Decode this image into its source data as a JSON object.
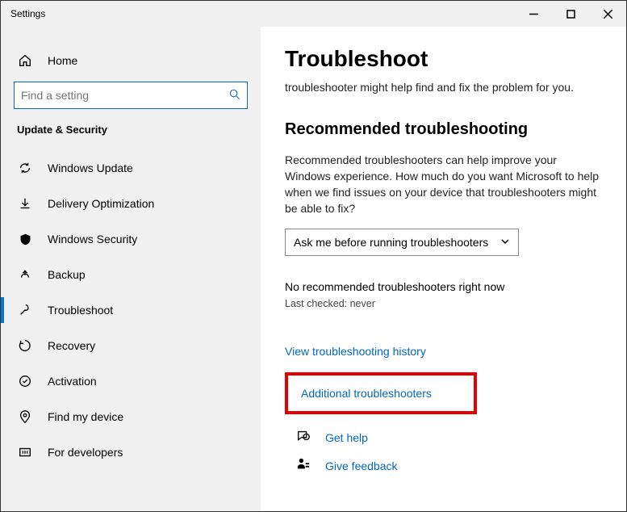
{
  "window": {
    "title": "Settings"
  },
  "sidebar": {
    "home": "Home",
    "search_placeholder": "Find a setting",
    "section": "Update & Security",
    "items": [
      {
        "label": "Windows Update"
      },
      {
        "label": "Delivery Optimization"
      },
      {
        "label": "Windows Security"
      },
      {
        "label": "Backup"
      },
      {
        "label": "Troubleshoot"
      },
      {
        "label": "Recovery"
      },
      {
        "label": "Activation"
      },
      {
        "label": "Find my device"
      },
      {
        "label": "For developers"
      }
    ]
  },
  "content": {
    "title": "Troubleshoot",
    "desc": "troubleshooter might help find and fix the problem for you.",
    "section_title": "Recommended troubleshooting",
    "section_desc": "Recommended troubleshooters can help improve your Windows experience. How much do you want Microsoft to help when we find issues on your device that troubleshooters might be able to fix?",
    "dropdown_value": "Ask me before running troubleshooters",
    "status": "No recommended troubleshooters right now",
    "last_checked": "Last checked: never",
    "history_link": "View troubleshooting history",
    "additional_link": "Additional troubleshooters",
    "get_help": "Get help",
    "give_feedback": "Give feedback"
  }
}
